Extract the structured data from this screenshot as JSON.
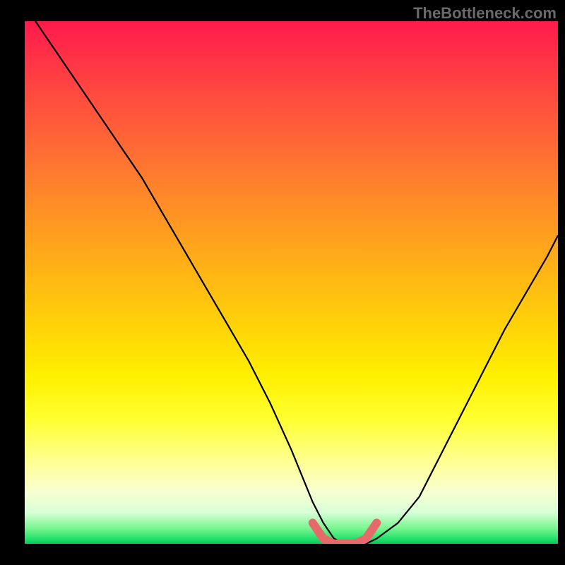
{
  "watermark": "TheBottleneck.com",
  "chart_data": {
    "type": "line",
    "title": "",
    "xlabel": "",
    "ylabel": "",
    "xlim": [
      0,
      100
    ],
    "ylim": [
      0,
      100
    ],
    "grid": false,
    "legend": false,
    "series": [
      {
        "name": "curve",
        "color": "#000000",
        "x": [
          2,
          6,
          10,
          14,
          18,
          22,
          26,
          30,
          34,
          38,
          42,
          46,
          50,
          52,
          54,
          56,
          58,
          60,
          62,
          64,
          66,
          70,
          74,
          78,
          82,
          86,
          90,
          94,
          98,
          100
        ],
        "values": [
          100,
          94,
          88,
          82,
          76,
          70,
          63,
          56,
          49,
          42,
          35,
          27,
          18,
          13,
          8,
          4,
          1,
          0,
          0,
          0,
          1,
          4,
          9,
          17,
          25,
          33,
          41,
          48,
          55,
          59
        ]
      },
      {
        "name": "highlight",
        "color": "#e76a6a",
        "x": [
          54,
          56,
          58,
          60,
          62,
          64,
          66
        ],
        "values": [
          4,
          1,
          0,
          0,
          0,
          1,
          4
        ]
      }
    ],
    "gradient_bands": [
      {
        "pos": 0.0,
        "color": "#ff1a4b"
      },
      {
        "pos": 0.06,
        "color": "#ff2f47"
      },
      {
        "pos": 0.14,
        "color": "#ff4a3f"
      },
      {
        "pos": 0.24,
        "color": "#ff6a35"
      },
      {
        "pos": 0.34,
        "color": "#ff8a28"
      },
      {
        "pos": 0.46,
        "color": "#ffae18"
      },
      {
        "pos": 0.58,
        "color": "#ffd208"
      },
      {
        "pos": 0.68,
        "color": "#fff000"
      },
      {
        "pos": 0.76,
        "color": "#ffff30"
      },
      {
        "pos": 0.84,
        "color": "#ffff90"
      },
      {
        "pos": 0.9,
        "color": "#f8ffd0"
      },
      {
        "pos": 0.94,
        "color": "#d8ffd8"
      },
      {
        "pos": 0.97,
        "color": "#7af590"
      },
      {
        "pos": 0.99,
        "color": "#25e26d"
      },
      {
        "pos": 1.0,
        "color": "#09c75a"
      }
    ]
  }
}
